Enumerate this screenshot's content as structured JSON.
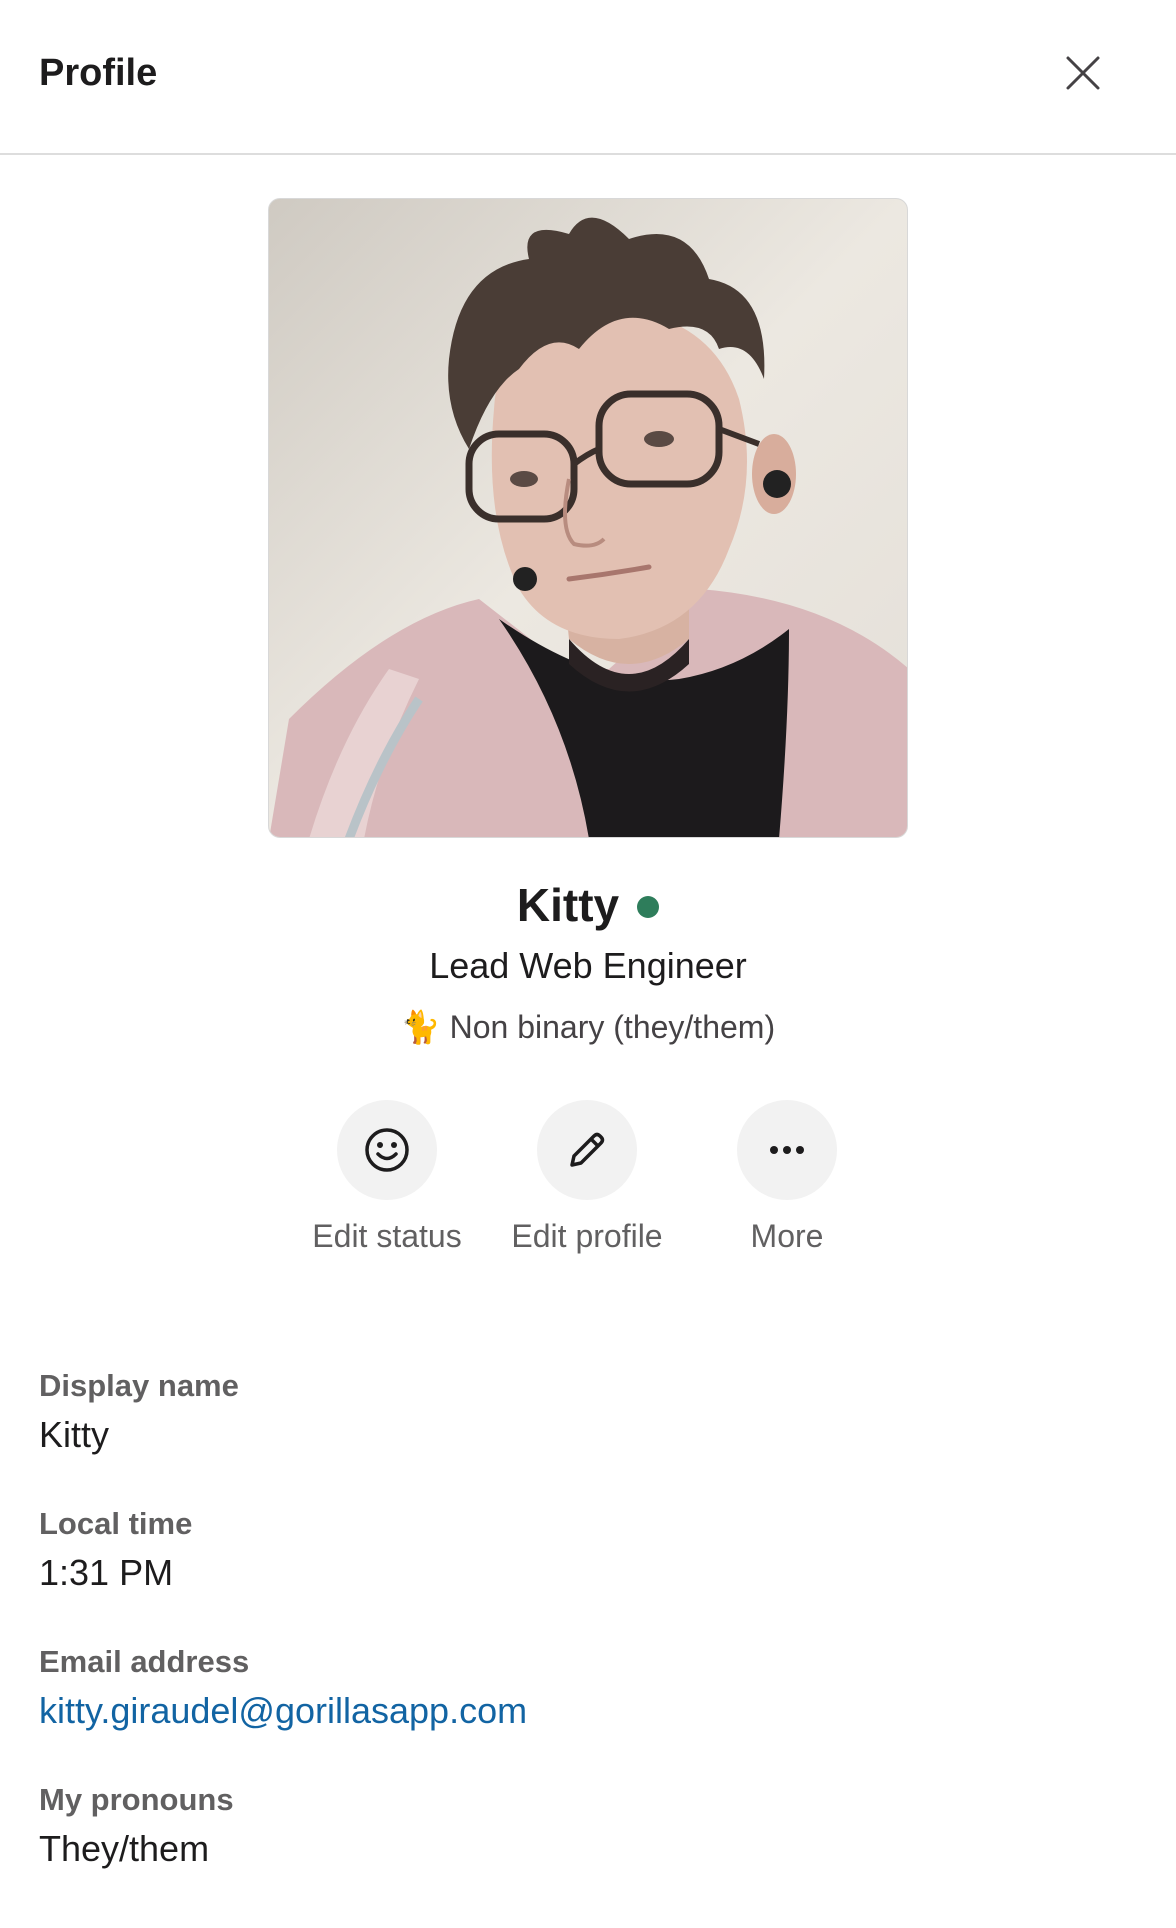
{
  "header": {
    "title": "Profile"
  },
  "profile": {
    "name": "Kitty",
    "title": "Lead Web Engineer",
    "pronoun_emoji": "🐈",
    "pronoun_line": "Non binary (they/them)",
    "presence_color": "#2e7d5b"
  },
  "actions": [
    {
      "label": "Edit status",
      "icon": "smiley-icon"
    },
    {
      "label": "Edit profile",
      "icon": "pencil-icon"
    },
    {
      "label": "More",
      "icon": "more-horizontal-icon"
    }
  ],
  "fields": [
    {
      "label": "Display name",
      "value": "Kitty"
    },
    {
      "label": "Local time",
      "value": "1:31 PM"
    },
    {
      "label": "Email address",
      "value": "kitty.giraudel@gorillasapp.com"
    },
    {
      "label": "My pronouns",
      "value": "They/them"
    }
  ],
  "colors": {
    "accent_link": "#1264a3",
    "divider": "#dddddd",
    "presence": "#2e7d5b"
  }
}
